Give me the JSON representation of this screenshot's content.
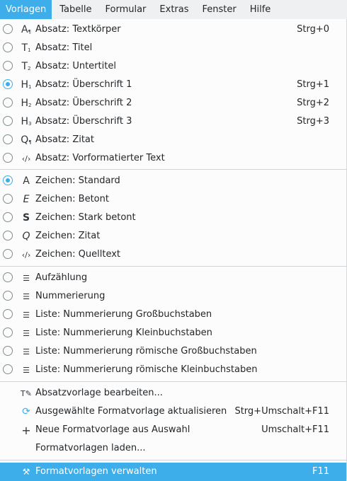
{
  "menubar": [
    "Vorlagen",
    "Tabelle",
    "Formular",
    "Extras",
    "Fenster",
    "Hilfe"
  ],
  "items": [
    {
      "label": "Absatz: Textkörper",
      "shortcut": "Strg+0",
      "icon": "A",
      "sub": "¶",
      "checked": false
    },
    {
      "label": "Absatz: Titel",
      "shortcut": "",
      "icon": "T",
      "sub": "1",
      "checked": false
    },
    {
      "label": "Absatz: Untertitel",
      "shortcut": "",
      "icon": "T",
      "sub": "2",
      "checked": false
    },
    {
      "label": "Absatz: Überschrift 1",
      "shortcut": "Strg+1",
      "icon": "H",
      "sub": "1",
      "checked": true
    },
    {
      "label": "Absatz: Überschrift 2",
      "shortcut": "Strg+2",
      "icon": "H",
      "sub": "2",
      "checked": false
    },
    {
      "label": "Absatz: Überschrift 3",
      "shortcut": "Strg+3",
      "icon": "H",
      "sub": "3",
      "checked": false
    },
    {
      "label": "Absatz: Zitat",
      "shortcut": "",
      "icon": "Q",
      "sub": "¶",
      "checked": false
    },
    {
      "label": "Absatz: Vorformatierter Text",
      "shortcut": "",
      "icon": "‹/›",
      "sub": "",
      "checked": false
    },
    {
      "label": "Zeichen: Standard",
      "shortcut": "",
      "icon": "A",
      "sub": "",
      "checked": true
    },
    {
      "label": "Zeichen: Betont",
      "shortcut": "",
      "icon": "E",
      "sub": "",
      "checked": false
    },
    {
      "label": "Zeichen: Stark betont",
      "shortcut": "",
      "icon": "S",
      "sub": "",
      "checked": false
    },
    {
      "label": "Zeichen: Zitat",
      "shortcut": "",
      "icon": "Q",
      "sub": "",
      "checked": false
    },
    {
      "label": "Zeichen: Quelltext",
      "shortcut": "",
      "icon": "‹/›",
      "sub": "",
      "checked": false
    },
    {
      "label": "Aufzählung",
      "shortcut": "",
      "icon": "☰",
      "sub": "",
      "checked": false
    },
    {
      "label": "Nummerierung",
      "shortcut": "",
      "icon": "☰",
      "sub": "",
      "checked": false
    },
    {
      "label": "Liste: Nummerierung Großbuchstaben",
      "shortcut": "",
      "icon": "☰",
      "sub": "",
      "checked": false
    },
    {
      "label": "Liste: Nummerierung Kleinbuchstaben",
      "shortcut": "",
      "icon": "☰",
      "sub": "",
      "checked": false
    },
    {
      "label": "Liste: Nummerierung römische Großbuchstaben",
      "shortcut": "",
      "icon": "☰",
      "sub": "",
      "checked": false
    },
    {
      "label": "Liste: Nummerierung römische Kleinbuchstaben",
      "shortcut": "",
      "icon": "☰",
      "sub": "",
      "checked": false
    },
    {
      "label": "Absatzvorlage bearbeiten...",
      "shortcut": "",
      "icon": "T✎",
      "sub": ""
    },
    {
      "label": "Ausgewählte Formatvorlage aktualisieren",
      "shortcut": "Strg+Umschalt+F11",
      "icon": "⟳",
      "sub": ""
    },
    {
      "label": "Neue Formatvorlage aus Auswahl",
      "shortcut": "Umschalt+F11",
      "icon": "+",
      "sub": ""
    },
    {
      "label": "Formatvorlagen laden...",
      "shortcut": "",
      "icon": "",
      "sub": ""
    },
    {
      "label": "Formatvorlagen verwalten",
      "shortcut": "F11",
      "icon": "⚒",
      "sub": ""
    }
  ],
  "colors": {
    "accent": "#3daee9",
    "background": "#fcfcfc",
    "menubar": "#eff0f1"
  }
}
